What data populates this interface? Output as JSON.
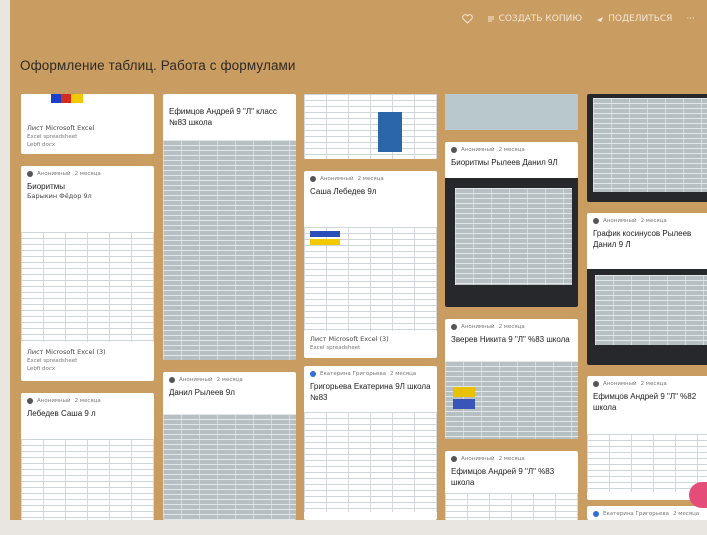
{
  "toolbar": {
    "copy_label": "СОЗДАТЬ КОПИЮ",
    "share_label": "ПОДЕЛИТЬСЯ",
    "more_label": "···"
  },
  "board": {
    "title": "Оформление таблиц. Работа с формулами"
  },
  "colors": {
    "board_bg": "#c99c61",
    "card_bg": "#ffffff",
    "avatar": "#2f6fd6",
    "accent": "#e44c7a"
  },
  "cards": {
    "c1": {
      "title": "Лист Microsoft Excel",
      "sub": "Excel spreadsheet",
      "small": "Lebfi docx"
    },
    "c2": {
      "author": "Анонимный",
      "time": "2 месяца",
      "title": "Биоритмы",
      "sub": "Барыкин Фёдор 9л",
      "file": "Лист Microsoft Excel (3)",
      "filetype": "Excel spreadsheet",
      "small": "Lebfi docx"
    },
    "c3": {
      "author": "Анонимный",
      "time": "2 месяца",
      "title": "Лебедев Саша 9 л"
    },
    "c4": {
      "title": "Ефимцов Андрей 9 \"Л\" класс №83 школа"
    },
    "c5": {
      "author": "Анонимный",
      "time": "2 месяца",
      "title": "Данил Рылеев 9л"
    },
    "c6": {
      "author": "Анонимный",
      "time": "2 месяца",
      "title": "Саша Лебедев 9л",
      "file": "Лист Microsoft Excel (3)",
      "filetype": "Excel spreadsheet",
      "small": "Lebfi docx"
    },
    "c7": {
      "author": "Екатерина Григорьева",
      "time": "2 месяца",
      "title": "Григорьева Екатерина 9Л школа №83"
    },
    "c8": {
      "author": "Анонимный",
      "time": "2 месяца",
      "title": "Биоритмы Рылеев Данил 9Л"
    },
    "c9": {
      "author": "Анонимный",
      "time": "2 месяца",
      "title": "Зверев Никита 9 \"Л\" %83 школа"
    },
    "c10": {
      "author": "Анонимный",
      "time": "2 месяца",
      "title": "Ефимцов Андрей 9 \"Л\" %83 школа"
    },
    "c11": {
      "author": "Анонимный",
      "time": "2 месяца",
      "title": "График косинусов Рылеев Данил 9 Л"
    },
    "c12": {
      "author": "Анонимный",
      "time": "2 месяца",
      "title": "Ефимцов Андрей 9 \"Л\" %82 школа"
    },
    "c13": {
      "author": "Екатерина Григорьева",
      "time": "2 месяца"
    }
  }
}
